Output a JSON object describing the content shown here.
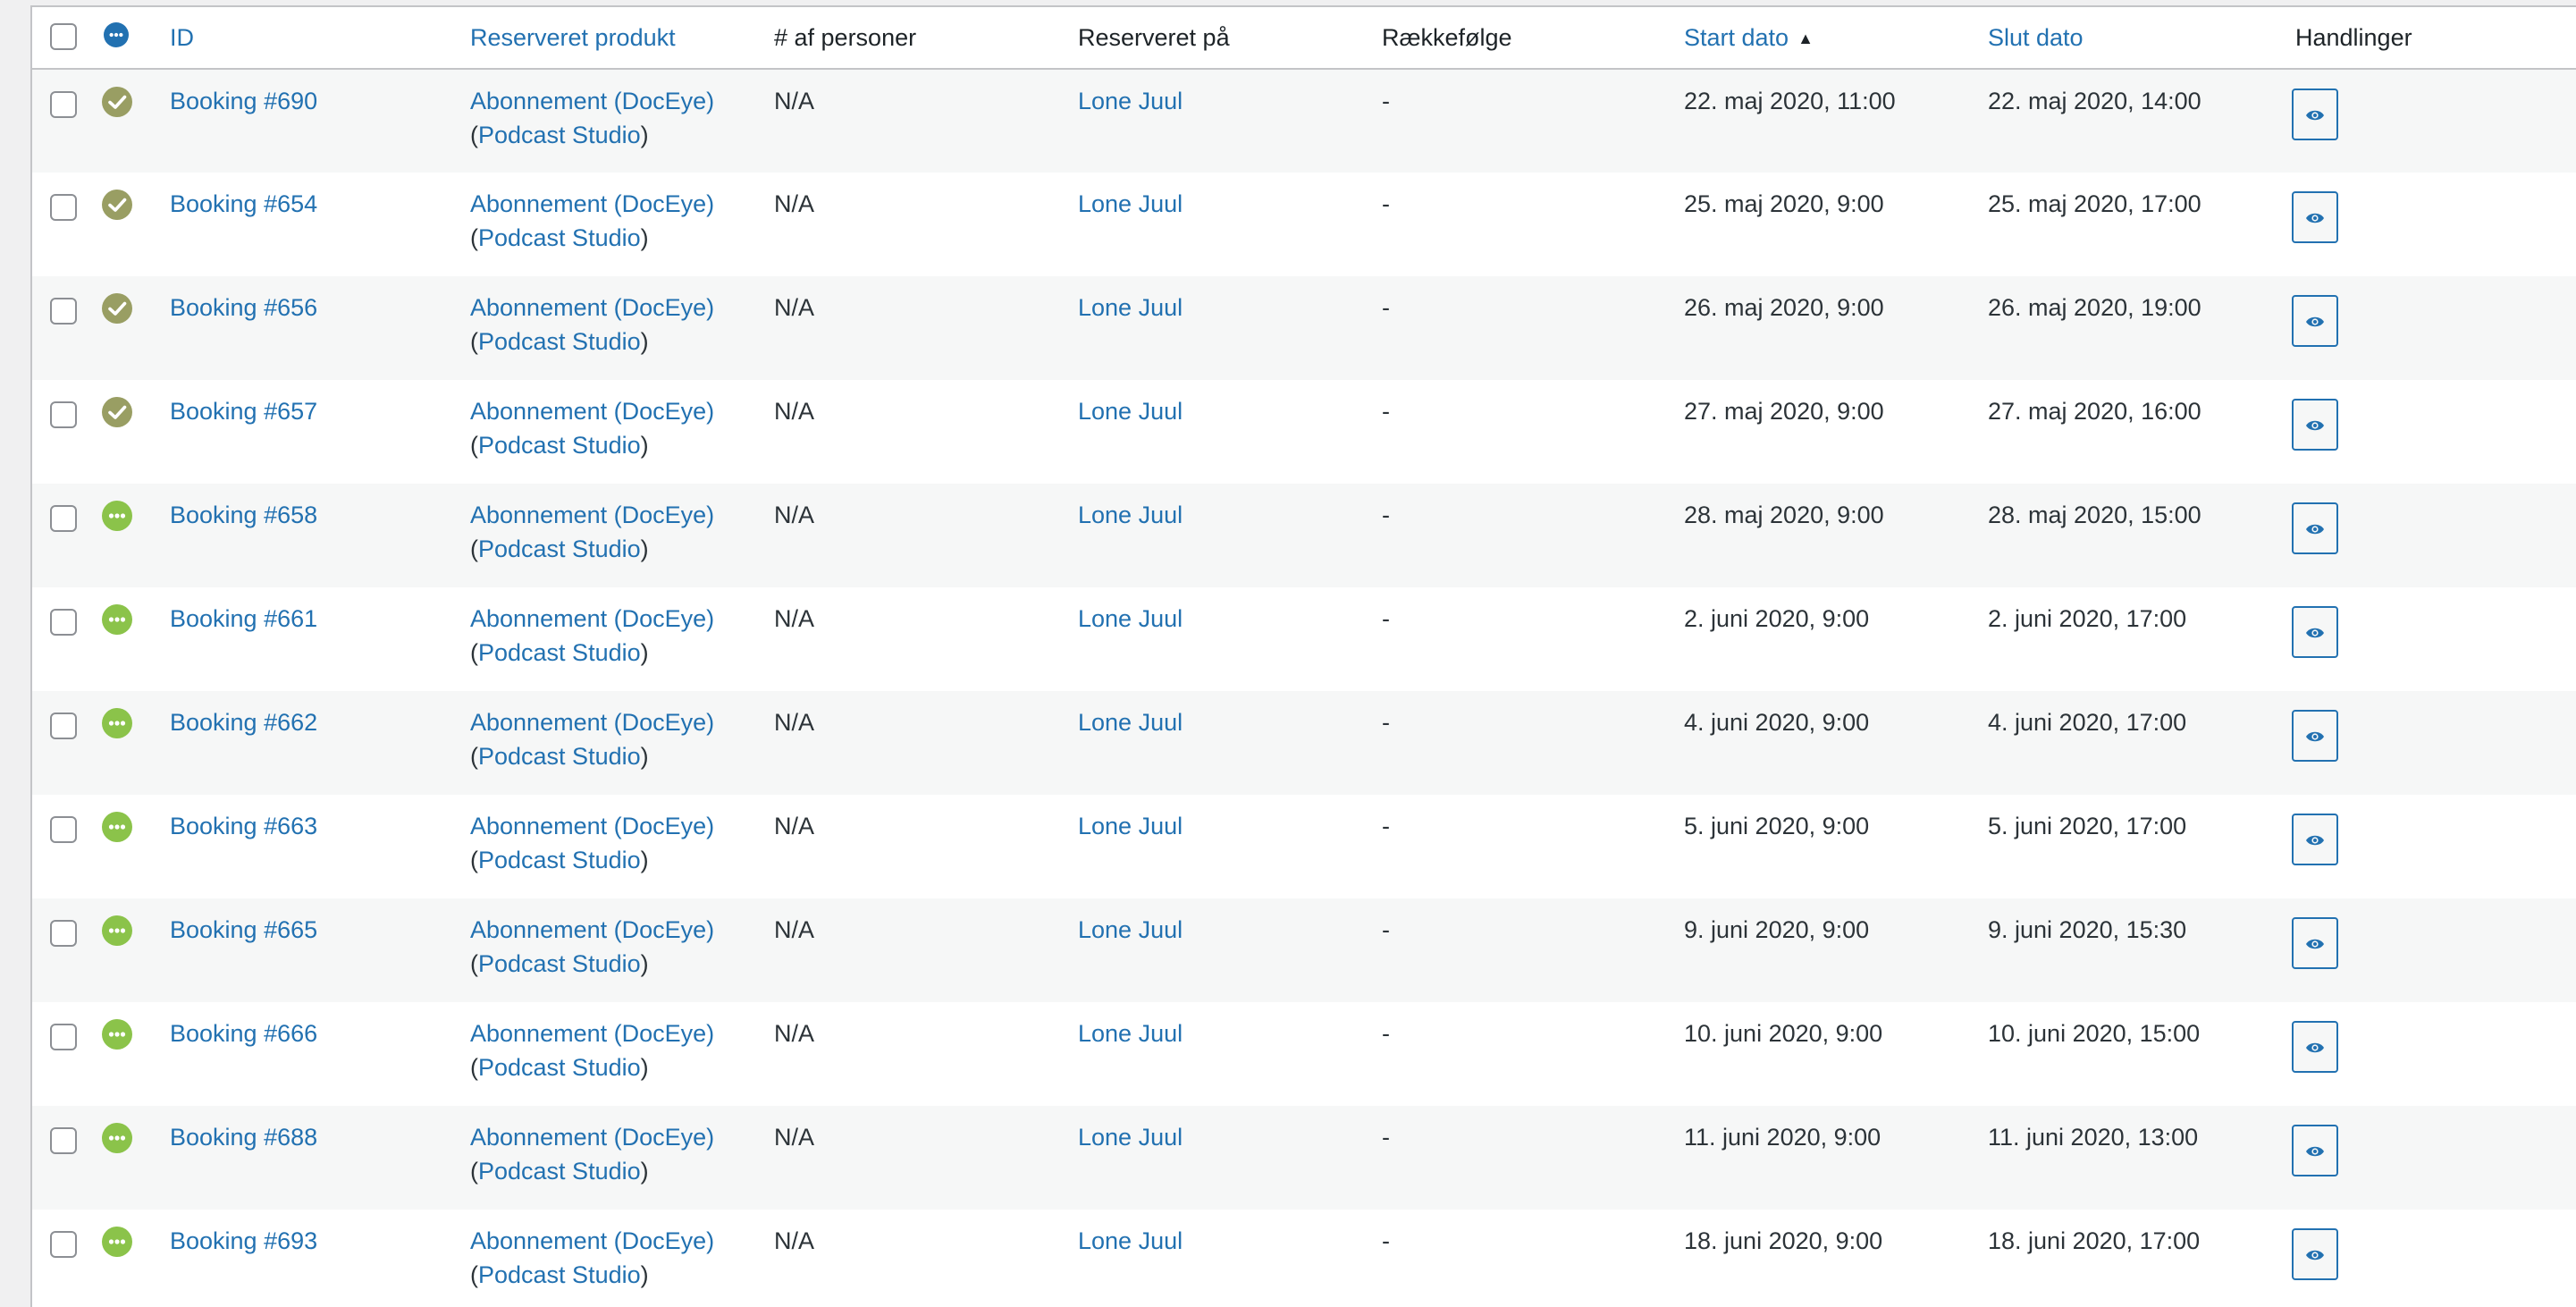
{
  "colors": {
    "link": "#2271b1",
    "complete": "#999e63",
    "pending": "#8bc34a",
    "header_status": "#2271b1"
  },
  "columns": {
    "id": "ID",
    "product": "Reserveret produkt",
    "persons": "# af personer",
    "reserved_by": "Reserveret på",
    "order": "Rækkefølge",
    "start": "Start dato",
    "end": "Slut dato",
    "actions": "Handlinger"
  },
  "header_status_icon": "ellipsis-icon",
  "sort": {
    "column": "start",
    "direction": "ascending"
  },
  "rows": [
    {
      "status": "complete",
      "status_icon": "check-icon",
      "id": "Booking #690",
      "product": "Abonnement (DocEye)",
      "product_paren_open": "(",
      "resource": "Podcast Studio",
      "product_paren_close": ")",
      "persons": "N/A",
      "reserved_by": "Lone Juul",
      "order": "-",
      "start": "22. maj 2020, 11:00",
      "end": "22. maj 2020, 14:00",
      "action_icon": "eye-icon"
    },
    {
      "status": "complete",
      "status_icon": "check-icon",
      "id": "Booking #654",
      "product": "Abonnement (DocEye)",
      "product_paren_open": "(",
      "resource": "Podcast Studio",
      "product_paren_close": ")",
      "persons": "N/A",
      "reserved_by": "Lone Juul",
      "order": "-",
      "start": "25. maj 2020, 9:00",
      "end": "25. maj 2020, 17:00",
      "action_icon": "eye-icon"
    },
    {
      "status": "complete",
      "status_icon": "check-icon",
      "id": "Booking #656",
      "product": "Abonnement (DocEye)",
      "product_paren_open": "(",
      "resource": "Podcast Studio",
      "product_paren_close": ")",
      "persons": "N/A",
      "reserved_by": "Lone Juul",
      "order": "-",
      "start": "26. maj 2020, 9:00",
      "end": "26. maj 2020, 19:00",
      "action_icon": "eye-icon"
    },
    {
      "status": "complete",
      "status_icon": "check-icon",
      "id": "Booking #657",
      "product": "Abonnement (DocEye)",
      "product_paren_open": "(",
      "resource": "Podcast Studio",
      "product_paren_close": ")",
      "persons": "N/A",
      "reserved_by": "Lone Juul",
      "order": "-",
      "start": "27. maj 2020, 9:00",
      "end": "27. maj 2020, 16:00",
      "action_icon": "eye-icon"
    },
    {
      "status": "pending",
      "status_icon": "ellipsis-icon",
      "id": "Booking #658",
      "product": "Abonnement (DocEye)",
      "product_paren_open": "(",
      "resource": "Podcast Studio",
      "product_paren_close": ")",
      "persons": "N/A",
      "reserved_by": "Lone Juul",
      "order": "-",
      "start": "28. maj 2020, 9:00",
      "end": "28. maj 2020, 15:00",
      "action_icon": "eye-icon"
    },
    {
      "status": "pending",
      "status_icon": "ellipsis-icon",
      "id": "Booking #661",
      "product": "Abonnement (DocEye)",
      "product_paren_open": "(",
      "resource": "Podcast Studio",
      "product_paren_close": ")",
      "persons": "N/A",
      "reserved_by": "Lone Juul",
      "order": "-",
      "start": "2. juni 2020, 9:00",
      "end": "2. juni 2020, 17:00",
      "action_icon": "eye-icon"
    },
    {
      "status": "pending",
      "status_icon": "ellipsis-icon",
      "id": "Booking #662",
      "product": "Abonnement (DocEye)",
      "product_paren_open": "(",
      "resource": "Podcast Studio",
      "product_paren_close": ")",
      "persons": "N/A",
      "reserved_by": "Lone Juul",
      "order": "-",
      "start": "4. juni 2020, 9:00",
      "end": "4. juni 2020, 17:00",
      "action_icon": "eye-icon"
    },
    {
      "status": "pending",
      "status_icon": "ellipsis-icon",
      "id": "Booking #663",
      "product": "Abonnement (DocEye)",
      "product_paren_open": "(",
      "resource": "Podcast Studio",
      "product_paren_close": ")",
      "persons": "N/A",
      "reserved_by": "Lone Juul",
      "order": "-",
      "start": "5. juni 2020, 9:00",
      "end": "5. juni 2020, 17:00",
      "action_icon": "eye-icon"
    },
    {
      "status": "pending",
      "status_icon": "ellipsis-icon",
      "id": "Booking #665",
      "product": "Abonnement (DocEye)",
      "product_paren_open": "(",
      "resource": "Podcast Studio",
      "product_paren_close": ")",
      "persons": "N/A",
      "reserved_by": "Lone Juul",
      "order": "-",
      "start": "9. juni 2020, 9:00",
      "end": "9. juni 2020, 15:30",
      "action_icon": "eye-icon"
    },
    {
      "status": "pending",
      "status_icon": "ellipsis-icon",
      "id": "Booking #666",
      "product": "Abonnement (DocEye)",
      "product_paren_open": "(",
      "resource": "Podcast Studio",
      "product_paren_close": ")",
      "persons": "N/A",
      "reserved_by": "Lone Juul",
      "order": "-",
      "start": "10. juni 2020, 9:00",
      "end": "10. juni 2020, 15:00",
      "action_icon": "eye-icon"
    },
    {
      "status": "pending",
      "status_icon": "ellipsis-icon",
      "id": "Booking #688",
      "product": "Abonnement (DocEye)",
      "product_paren_open": "(",
      "resource": "Podcast Studio",
      "product_paren_close": ")",
      "persons": "N/A",
      "reserved_by": "Lone Juul",
      "order": "-",
      "start": "11. juni 2020, 9:00",
      "end": "11. juni 2020, 13:00",
      "action_icon": "eye-icon"
    },
    {
      "status": "pending",
      "status_icon": "ellipsis-icon",
      "id": "Booking #693",
      "product": "Abonnement (DocEye)",
      "product_paren_open": "(",
      "resource": "Podcast Studio",
      "product_paren_close": ")",
      "persons": "N/A",
      "reserved_by": "Lone Juul",
      "order": "-",
      "start": "18. juni 2020, 9:00",
      "end": "18. juni 2020, 17:00",
      "action_icon": "eye-icon"
    }
  ]
}
